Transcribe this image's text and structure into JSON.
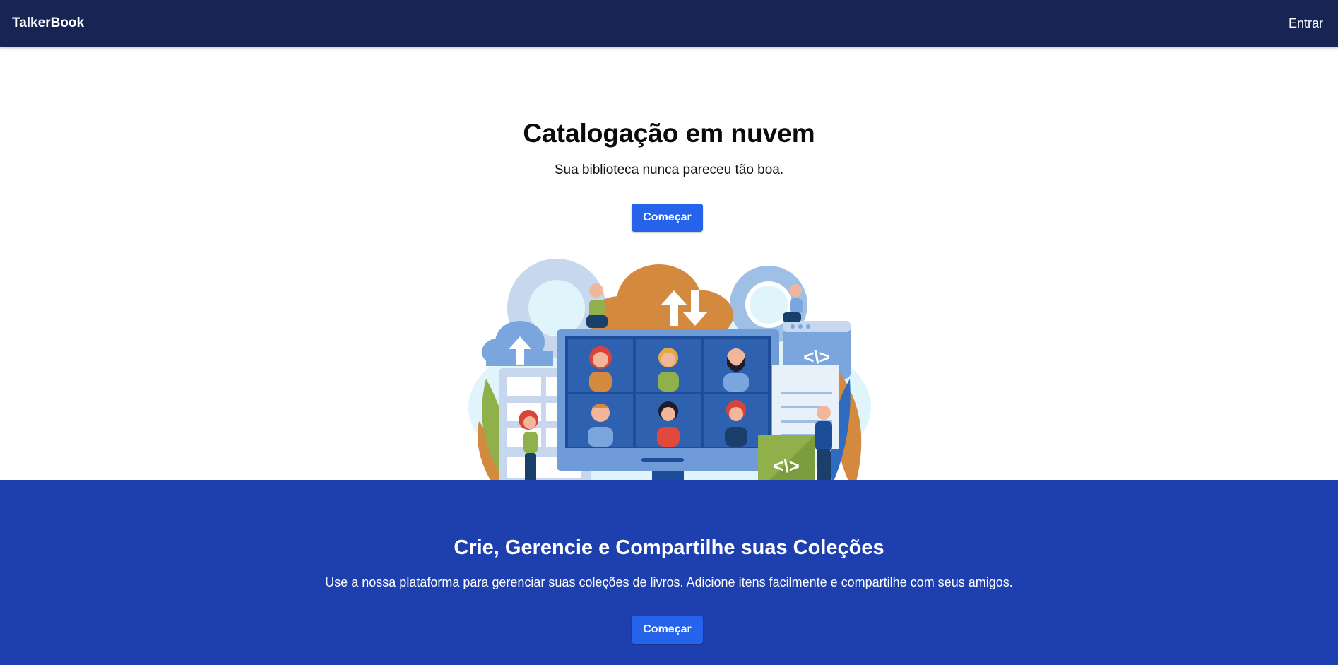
{
  "navbar": {
    "brand": "TalkerBook",
    "login_label": "Entrar"
  },
  "hero": {
    "title": "Catalogação em nuvem",
    "subtitle": "Sua biblioteca nunca pareceu tão boa.",
    "cta_label": "Começar",
    "illustration_code_symbol": "<\\>"
  },
  "feature": {
    "title": "Crie, Gerencie e Compartilhe suas Coleções",
    "description": "Use a nossa plataforma para gerenciar suas coleções de livros. Adicione itens facilmente e compartilhe com seus amigos.",
    "cta_label": "Começar"
  },
  "colors": {
    "navbar_bg": "#172554",
    "button_bg": "#2563eb",
    "feature_bg": "#1e40af"
  }
}
